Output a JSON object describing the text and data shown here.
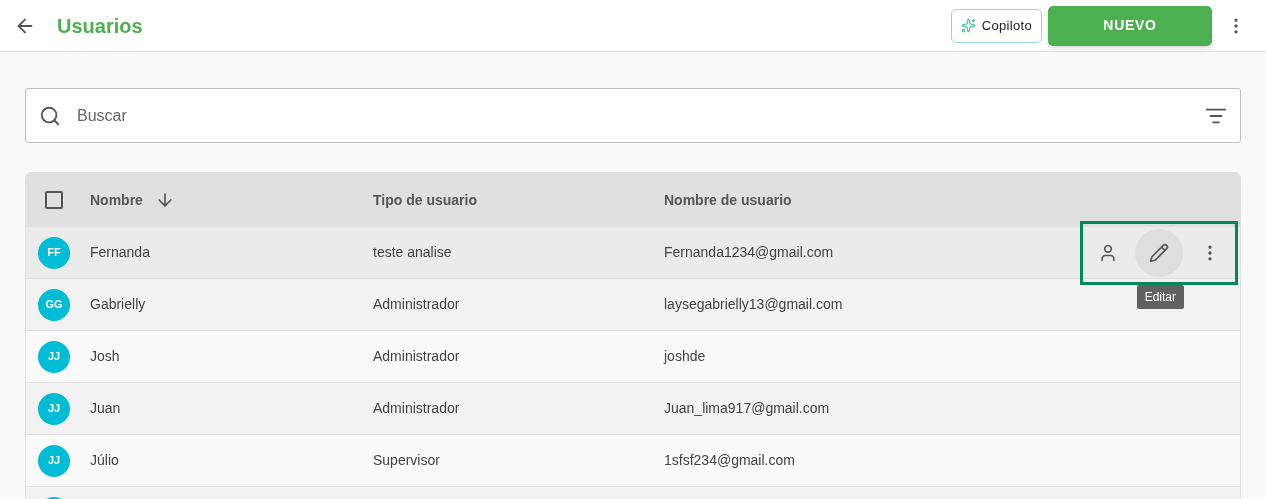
{
  "header": {
    "title": "Usuarios",
    "copilot_button": "Copiloto",
    "new_button": "NUEVO"
  },
  "search": {
    "placeholder": "Buscar"
  },
  "table": {
    "select_all_checked": false,
    "columns": [
      "Nombre",
      "Tipo de usuario",
      "Nombre de usuario"
    ],
    "rows": [
      {
        "initials": "FF",
        "name": "Fernanda",
        "type": "teste analise",
        "username": "Fernanda1234@gmail.com",
        "hovered": true
      },
      {
        "initials": "GG",
        "name": "Gabrielly",
        "type": "Administrador",
        "username": "laysegabrielly13@gmail.com",
        "hovered": false
      },
      {
        "initials": "JJ",
        "name": "Josh",
        "type": "Administrador",
        "username": "joshde",
        "hovered": false
      },
      {
        "initials": "JJ",
        "name": "Juan",
        "type": "Administrador",
        "username": "Juan_lima917@gmail.com",
        "hovered": false
      },
      {
        "initials": "JJ",
        "name": "Júlio",
        "type": "Supervisor",
        "username": "1sfsf234@gmail.com",
        "hovered": false
      }
    ],
    "tooltip": "Editar"
  }
}
